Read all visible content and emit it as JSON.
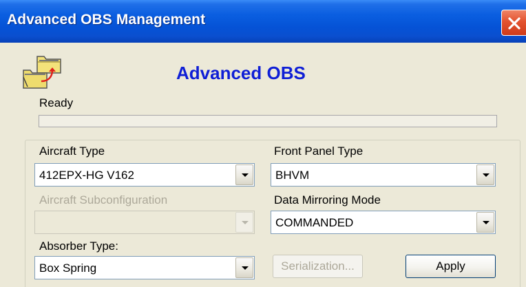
{
  "window": {
    "title": "Advanced OBS Management"
  },
  "header": {
    "heading": "Advanced OBS",
    "app_icon": "folder-transfer-icon"
  },
  "status": {
    "text": "Ready",
    "progress": 0
  },
  "form": {
    "aircraft_type": {
      "label": "Aircraft Type",
      "value": "412EPX-HG V162"
    },
    "aircraft_subconfiguration": {
      "label": "Aircraft Subconfiguration",
      "value": "",
      "disabled": true
    },
    "absorber_type": {
      "label": "Absorber Type:",
      "value": "Box Spring"
    },
    "front_panel_type": {
      "label": "Front Panel Type",
      "value": "BHVM"
    },
    "data_mirroring_mode": {
      "label": "Data Mirroring Mode",
      "value": "COMMANDED"
    }
  },
  "buttons": {
    "serialization": {
      "label": "Serialization...",
      "disabled": true
    },
    "apply": {
      "label": "Apply"
    }
  },
  "colors": {
    "heading": "#0f1fd6",
    "titlebar": "#0552d6",
    "close": "#e3532f",
    "window_bg": "#ece9d8"
  }
}
